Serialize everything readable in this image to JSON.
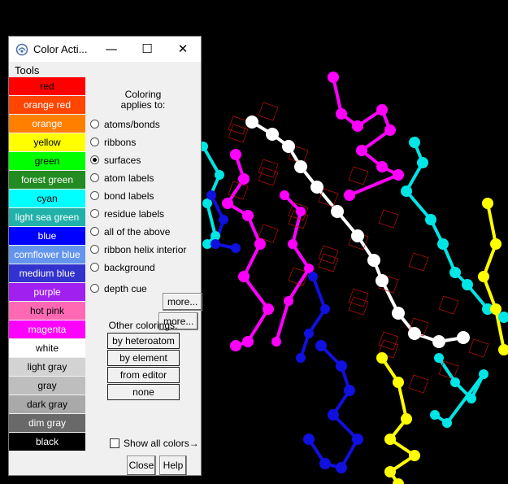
{
  "window": {
    "title": "Color Acti...",
    "minimize_icon": "minimize-icon",
    "maximize_icon": "maximize-icon",
    "close_icon": "close-icon"
  },
  "menu": {
    "tools": "Tools"
  },
  "swatches": [
    {
      "label": "red",
      "bg": "#ff0000",
      "fg": "#000000"
    },
    {
      "label": "orange red",
      "bg": "#ff4500",
      "fg": "#ffffff"
    },
    {
      "label": "orange",
      "bg": "#ff7f00",
      "fg": "#ffffff"
    },
    {
      "label": "yellow",
      "bg": "#ffff00",
      "fg": "#000000"
    },
    {
      "label": "green",
      "bg": "#00ff00",
      "fg": "#000000"
    },
    {
      "label": "forest green",
      "bg": "#228b22",
      "fg": "#ffffff"
    },
    {
      "label": "cyan",
      "bg": "#00ffff",
      "fg": "#000000"
    },
    {
      "label": "light sea green",
      "bg": "#20b2aa",
      "fg": "#ffffff"
    },
    {
      "label": "blue",
      "bg": "#0000ff",
      "fg": "#ffffff"
    },
    {
      "label": "cornflower blue",
      "bg": "#6495ed",
      "fg": "#ffffff"
    },
    {
      "label": "medium blue",
      "bg": "#3232cd",
      "fg": "#ffffff"
    },
    {
      "label": "purple",
      "bg": "#a020f0",
      "fg": "#ffffff"
    },
    {
      "label": "hot pink",
      "bg": "#ff69b4",
      "fg": "#000000"
    },
    {
      "label": "magenta",
      "bg": "#ff00ff",
      "fg": "#ffffff"
    },
    {
      "label": "white",
      "bg": "#ffffff",
      "fg": "#000000"
    },
    {
      "label": "light gray",
      "bg": "#d3d3d3",
      "fg": "#000000"
    },
    {
      "label": "gray",
      "bg": "#bebebe",
      "fg": "#000000"
    },
    {
      "label": "dark gray",
      "bg": "#a9a9a9",
      "fg": "#000000"
    },
    {
      "label": "dim gray",
      "bg": "#696969",
      "fg": "#ffffff"
    },
    {
      "label": "black",
      "bg": "#000000",
      "fg": "#ffffff"
    }
  ],
  "coloring": {
    "title_line1": "Coloring",
    "title_line2": "applies to:",
    "selected": "surfaces",
    "options": [
      "atoms/bonds",
      "ribbons",
      "surfaces",
      "atom labels",
      "bond labels",
      "residue labels",
      "all of the above",
      "ribbon helix interior",
      "background",
      "depth cue"
    ],
    "more_label": "more..."
  },
  "other": {
    "title": "Other colorings:",
    "buttons": [
      "by heteroatom",
      "by element",
      "from editor",
      "none"
    ]
  },
  "show_all": {
    "label": "Show all colors",
    "arrow": "→",
    "checked": false
  },
  "buttons": {
    "close": "Close",
    "help": "Help"
  },
  "colors": {
    "accent": "#000000",
    "window_bg": "#f0f0f0",
    "mesh": "#cc0000"
  }
}
